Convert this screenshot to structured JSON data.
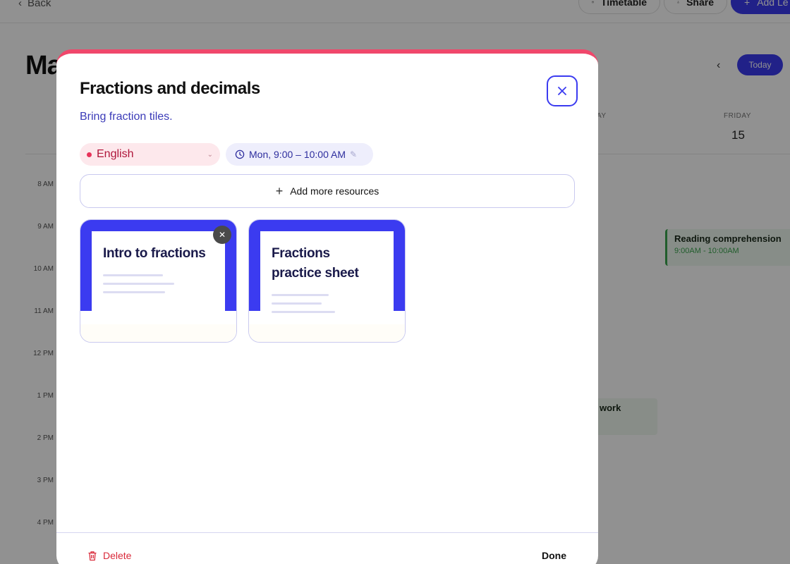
{
  "header": {
    "back_label": "Back",
    "timetable_label": "Timetable",
    "share_label": "Share",
    "add_label": "Add Le"
  },
  "page": {
    "title": "Ma",
    "today_label": "Today"
  },
  "calendar": {
    "days": [
      {
        "name": "AY",
        "number": ""
      },
      {
        "name": "FRIDAY",
        "number": "15"
      }
    ],
    "times": [
      "8 AM",
      "9 AM",
      "10 AM",
      "11 AM",
      "12 PM",
      "1 PM",
      "2 PM",
      "3 PM",
      "4 PM"
    ],
    "events": [
      {
        "title": "Reading comprehension",
        "time": "9:00AM - 10:00AM"
      },
      {
        "title": "work",
        "time": ""
      }
    ]
  },
  "modal": {
    "title": "Fractions and decimals",
    "subtitle": "Bring fraction tiles.",
    "accent_color": "#f0476b",
    "subject": {
      "label": "English",
      "color": "#e8325a"
    },
    "time_chip": "Mon, 9:00 – 10:00 AM",
    "add_resources_label": "Add more resources",
    "resources": [
      {
        "title": "Intro to fractions"
      },
      {
        "title": "Fractions practice sheet"
      }
    ],
    "delete_label": "Delete",
    "done_label": "Done"
  }
}
